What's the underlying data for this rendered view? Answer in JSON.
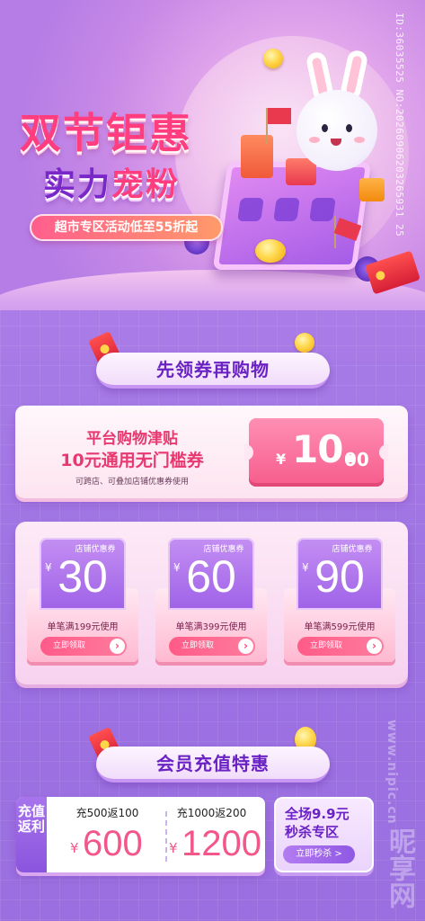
{
  "hero": {
    "title_line1": "双节钜惠",
    "title_line2_prefix": "实力",
    "title_line2_accent": "宠粉",
    "promo": "超市专区活动低至55折起"
  },
  "side_id": "ID:36035525 NO:20260906203265931 25",
  "coupon_section": {
    "title": "先领券再购物"
  },
  "platform_coupon": {
    "line1": "平台购物津贴",
    "line2": "10元通用无门槛券",
    "note": "可跨店、可叠加店铺优惠券使用",
    "yen": "¥",
    "amount_int": "10.",
    "amount_dec": "00"
  },
  "store_coupons": [
    {
      "label": "店铺优惠券",
      "yen": "¥",
      "value": "30",
      "condition": "单笔满199元使用",
      "button": "立即领取",
      "arrow": "›"
    },
    {
      "label": "店铺优惠券",
      "yen": "¥",
      "value": "60",
      "condition": "单笔满399元使用",
      "button": "立即领取",
      "arrow": "›"
    },
    {
      "label": "店铺优惠券",
      "yen": "¥",
      "value": "90",
      "condition": "单笔满599元使用",
      "button": "立即领取",
      "arrow": "›"
    }
  ],
  "member_section": {
    "title": "会员充值特惠"
  },
  "recharge": {
    "tag": "充值返利",
    "items": [
      {
        "condition": "充500返100",
        "yen": "¥",
        "value": "600"
      },
      {
        "condition": "充1000返200",
        "yen": "¥",
        "value": "1200"
      }
    ]
  },
  "flash_sale": {
    "line1": "全场9.9元",
    "line2": "秒杀专区",
    "button": "立即秒杀 >"
  },
  "watermark": {
    "site": "www.nipic.cn",
    "logo": "昵享网"
  },
  "colors": {
    "accent_pink": "#ff3d7f",
    "accent_purple": "#7a27c9",
    "background": "#a876e0"
  }
}
